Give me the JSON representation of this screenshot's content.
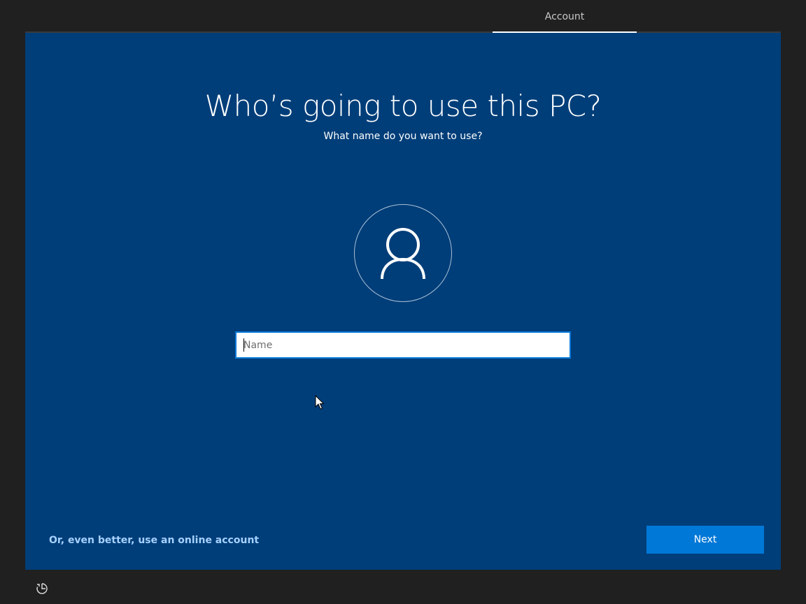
{
  "header": {
    "tab_label": "Account"
  },
  "main": {
    "title": "Who’s going to use this PC?",
    "subtitle": "What name do you want to use?",
    "avatar_icon": "user-icon",
    "name_input": {
      "placeholder": "Name",
      "value": ""
    }
  },
  "footer": {
    "online_account_link": "Or, even better, use an online account",
    "next_label": "Next",
    "accessibility_icon": "ease-of-access-icon"
  },
  "colors": {
    "panel_background": "#003e79",
    "accent": "#0078d7",
    "link": "#a6d1ff",
    "outer_background": "#202020"
  }
}
